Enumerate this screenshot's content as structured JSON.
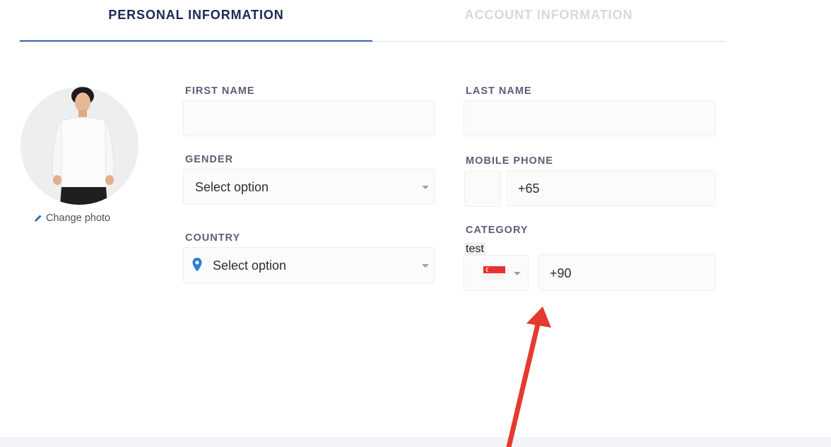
{
  "tabs": {
    "personal": "PERSONAL INFORMATION",
    "account": "ACCOUNT INFORMATION"
  },
  "avatar": {
    "change_photo_label": "Change photo"
  },
  "form": {
    "first_name": {
      "label": "FIRST NAME",
      "value": ""
    },
    "last_name": {
      "label": "LAST NAME",
      "value": ""
    },
    "gender": {
      "label": "GENDER",
      "selected": "Select option"
    },
    "mobile_phone": {
      "label": "MOBILE PHONE",
      "prefix": "+65"
    },
    "country": {
      "label": "COUNTRY",
      "selected": "Select option"
    },
    "category": {
      "label": "CATEGORY",
      "tag": "test",
      "prefix": "+90"
    }
  },
  "colors": {
    "accent": "#2d65ad",
    "active_tab_text": "#1b2a55",
    "inactive_tab_text": "#d5d9e2",
    "annotation_arrow": "#e43a2f",
    "pin_icon": "#2d7fd8"
  },
  "icons": {
    "change_photo": "pencil-icon",
    "country": "location-pin-icon",
    "flag": "singapore-flag-icon",
    "select": "caret-down-icon"
  }
}
